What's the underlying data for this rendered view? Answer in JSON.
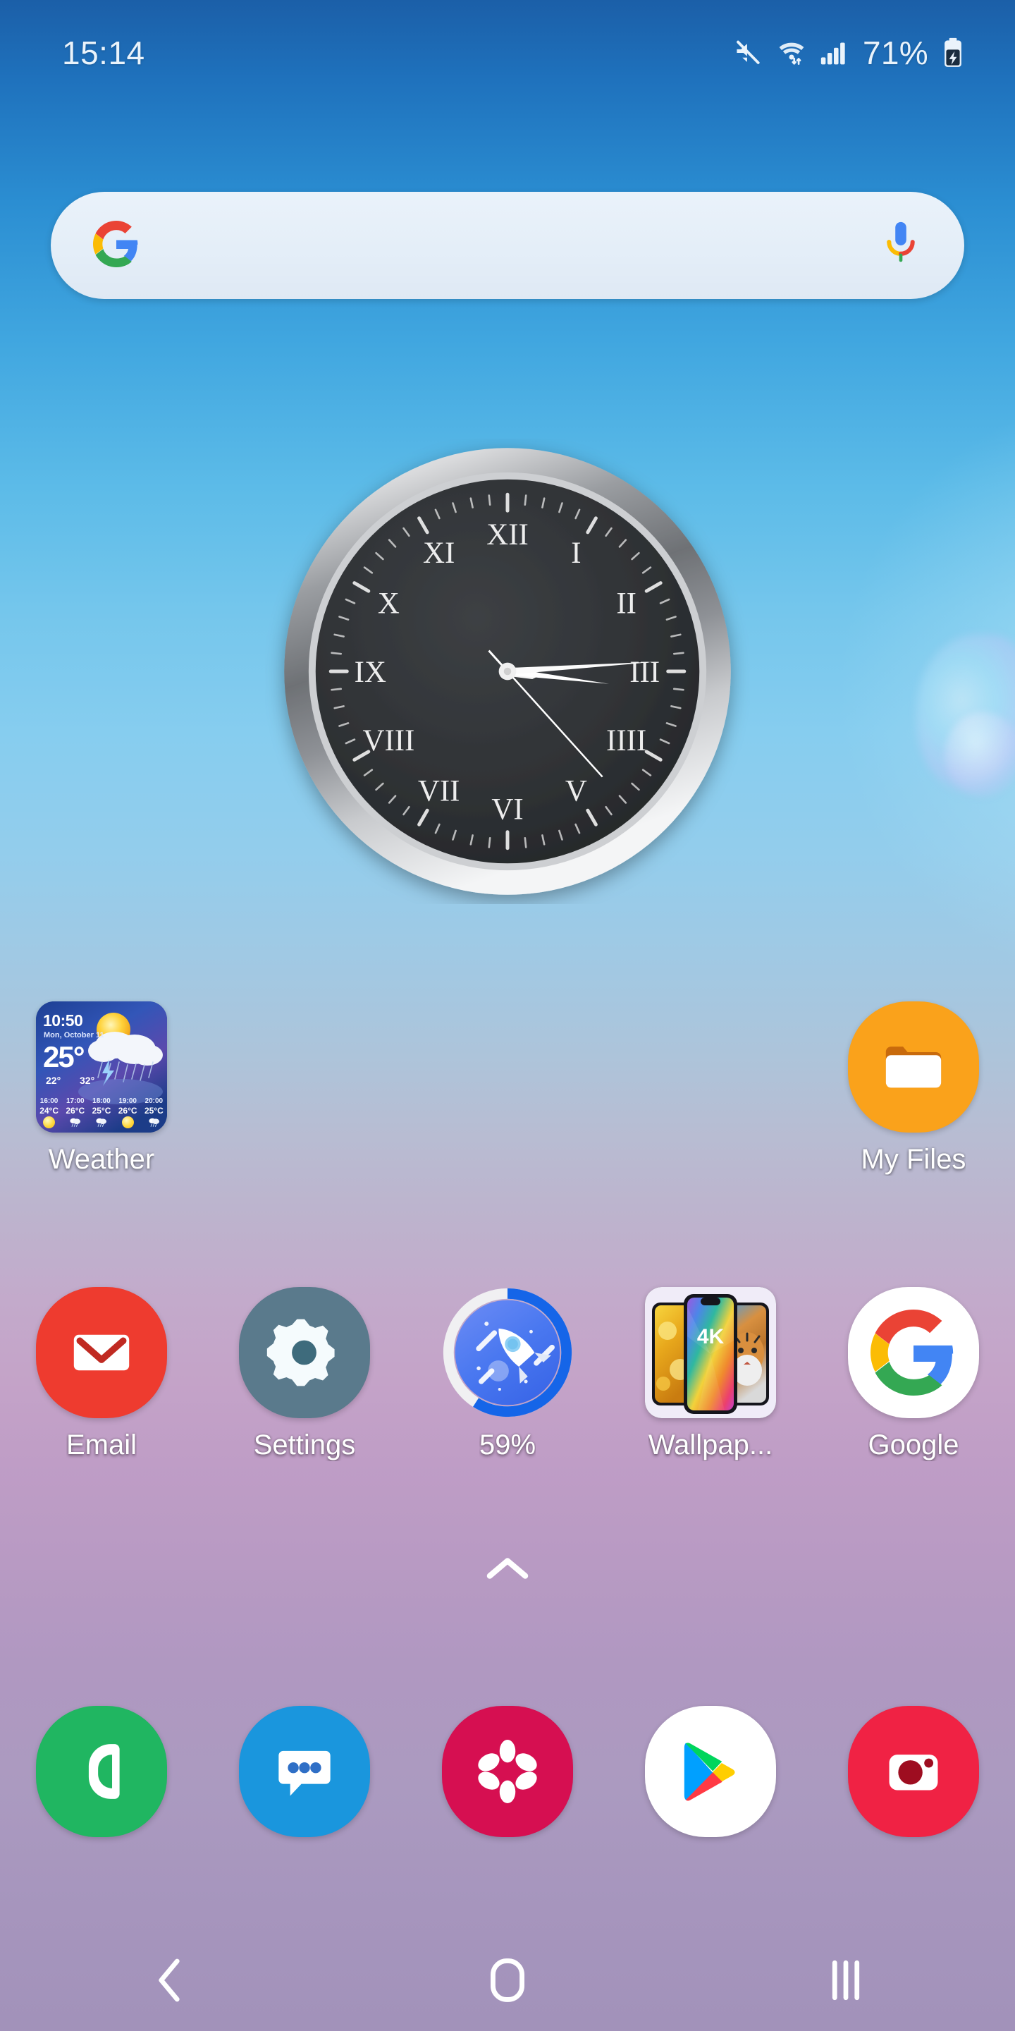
{
  "status_bar": {
    "time": "15:14",
    "battery_percent": "71%",
    "icons": [
      "mute-icon",
      "wifi-icon",
      "signal-icon",
      "battery-charging-icon"
    ]
  },
  "search": {
    "value": "",
    "placeholder": "",
    "left_icon": "google-g-icon",
    "right_icon": "microphone-icon"
  },
  "clock_widget": {
    "name": "analog-clock-widget",
    "hour": 3,
    "minute": 14,
    "second": 23,
    "numerals": [
      "XII",
      "I",
      "II",
      "III",
      "IIII",
      "V",
      "VI",
      "VII",
      "VIII",
      "IX",
      "X",
      "XI"
    ],
    "bezel_color": "#b9bcc0",
    "face_color": "#2e3033"
  },
  "weather_widget": {
    "time": "10:50",
    "date": "Mon, October 11",
    "temperature": "25°",
    "low": "22°",
    "high": "32°",
    "hourly": [
      {
        "hour": "16:00",
        "temp": "24°C",
        "icon": "sun-icon"
      },
      {
        "hour": "17:00",
        "temp": "26°C",
        "icon": "rain-cloud-icon"
      },
      {
        "hour": "18:00",
        "temp": "25°C",
        "icon": "rain-cloud-icon"
      },
      {
        "hour": "19:00",
        "temp": "26°C",
        "icon": "sun-icon"
      },
      {
        "hour": "20:00",
        "temp": "25°C",
        "icon": "rain-cloud-icon"
      }
    ]
  },
  "home_apps": {
    "row1": [
      {
        "label": "Weather",
        "icon": "weather-widget-icon"
      },
      {
        "label": "",
        "icon": ""
      },
      {
        "label": "",
        "icon": ""
      },
      {
        "label": "",
        "icon": ""
      },
      {
        "label": "My Files",
        "icon": "folder-icon"
      }
    ],
    "row2": [
      {
        "label": "Email",
        "icon": "envelope-icon"
      },
      {
        "label": "Settings",
        "icon": "gear-icon"
      },
      {
        "label": "59%",
        "icon": "rocket-booster-icon"
      },
      {
        "label": "Wallpap...",
        "icon": "wallpapers-icon"
      },
      {
        "label": "Google",
        "icon": "google-g-icon"
      }
    ]
  },
  "booster": {
    "percent_label": "59%",
    "percent_value": 59,
    "ring_color": "#1565e8",
    "ring_track_color": "#f0f0f2"
  },
  "wallpapers_icon": {
    "center_label": "4K"
  },
  "drawer_indicator": {
    "icon": "chevron-up-icon"
  },
  "dock": [
    {
      "name": "phone",
      "icon": "phone-icon",
      "color": "#20b661"
    },
    {
      "name": "messages",
      "icon": "message-bubble-icon",
      "color": "#1a96dd"
    },
    {
      "name": "gallery",
      "icon": "flower-icon",
      "color": "#d60f51"
    },
    {
      "name": "play-store",
      "icon": "play-store-icon",
      "color": "#ffffff"
    },
    {
      "name": "camera",
      "icon": "camera-icon",
      "color": "#f02244"
    }
  ],
  "nav_bar": {
    "back": "back-chevron-icon",
    "home": "home-icon",
    "recents": "recents-icon"
  },
  "colors": {
    "wallpaper_top": "#1b5fa8",
    "wallpaper_mid": "#86cdef",
    "wallpaper_bottom": "#a292ba",
    "status_text": "#eaf3fb",
    "label_text": "#ffffff"
  }
}
